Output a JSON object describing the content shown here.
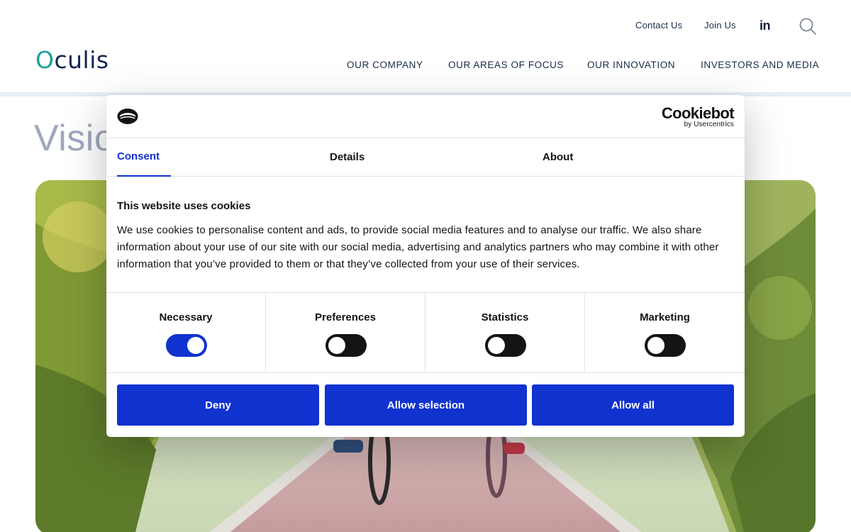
{
  "header": {
    "utility_links": {
      "contact": "Contact Us",
      "join": "Join Us"
    },
    "logo": {
      "first": "O",
      "rest": "culis"
    },
    "nav": [
      "OUR COMPANY",
      "OUR AREAS OF FOCUS",
      "OUR INNOVATION",
      "INVESTORS AND MEDIA"
    ],
    "icons": {
      "linkedin": "in",
      "search": "search-icon"
    }
  },
  "page": {
    "heading_visible": "Visio"
  },
  "cookie_dialog": {
    "brand": {
      "name": "Cookiebot",
      "sub": "by Usercentrics"
    },
    "tabs": [
      {
        "label": "Consent",
        "active": true
      },
      {
        "label": "Details",
        "active": false
      },
      {
        "label": "About",
        "active": false
      }
    ],
    "title": "This website uses cookies",
    "text": "We use cookies to personalise content and ads, to provide social media features and to analyse our traffic. We also share information about your use of our site with our social media, advertising and analytics partners who may combine it with other information that you’ve provided to them or that they’ve collected from your use of their services.",
    "toggles": [
      {
        "label": "Necessary",
        "checked": true
      },
      {
        "label": "Preferences",
        "checked": false
      },
      {
        "label": "Statistics",
        "checked": false
      },
      {
        "label": "Marketing",
        "checked": false
      }
    ],
    "buttons": {
      "deny": "Deny",
      "allow_selection": "Allow selection",
      "allow_all": "Allow all"
    },
    "colors": {
      "accent": "#1032cf",
      "toggle_off": "#141414"
    }
  }
}
